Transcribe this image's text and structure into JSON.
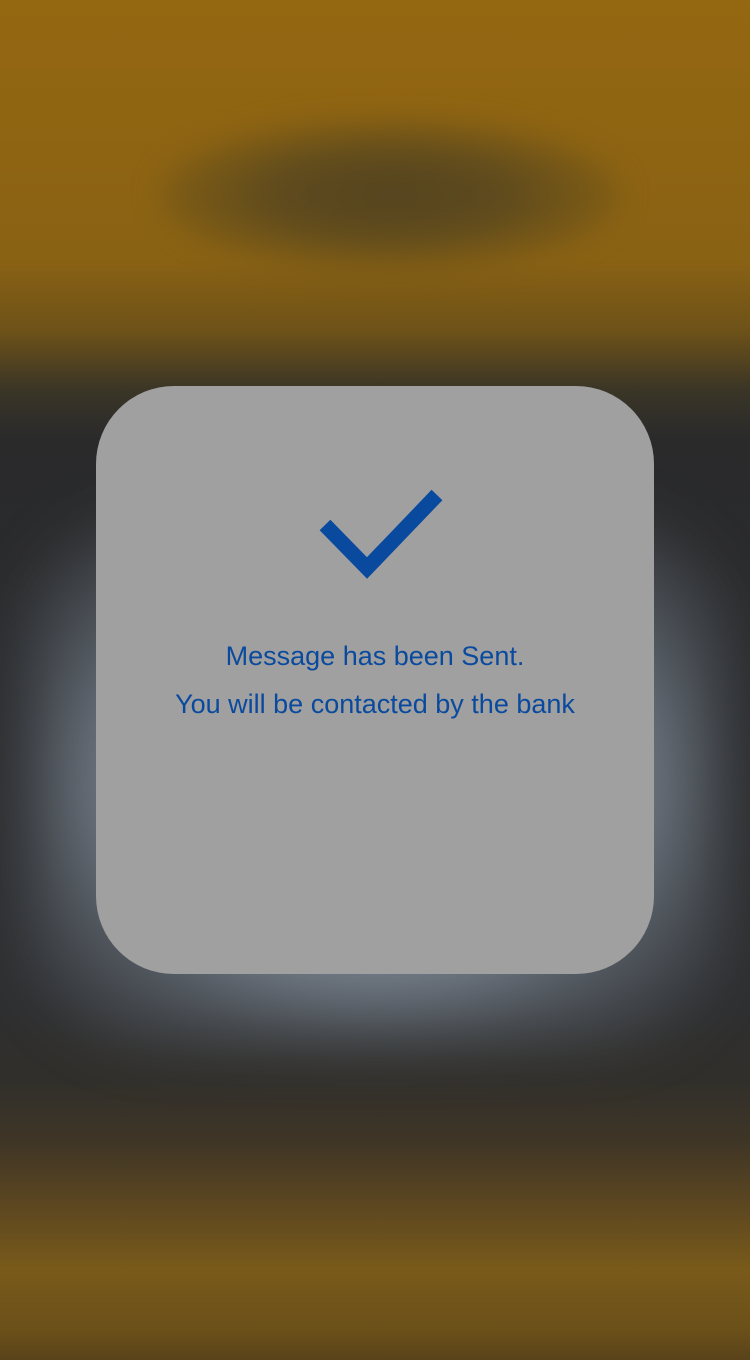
{
  "dialog": {
    "icon": "checkmark-icon",
    "line1": "Message has been Sent.",
    "line2": "You will be contacted by the bank"
  },
  "colors": {
    "accent": "#0a4a9e",
    "dialog_bg": "#a0a0a0",
    "backdrop_top": "#946711",
    "backdrop_mid": "#2b2c2e"
  }
}
